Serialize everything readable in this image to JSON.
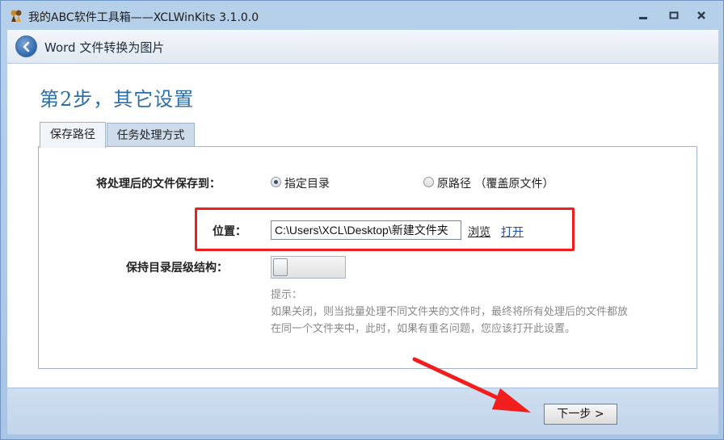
{
  "titlebar": {
    "title": "我的ABC软件工具箱——XCLWinKits  3.1.0.0",
    "icon": "app-logo-icon",
    "buttons": [
      "minimize-icon",
      "restore-icon",
      "close-icon"
    ]
  },
  "header": {
    "back_icon": "back-arrow-icon",
    "title": "Word 文件转换为图片"
  },
  "step_title": "第2步，其它设置",
  "tabs": [
    {
      "label": "保存路径",
      "active": true
    },
    {
      "label": "任务处理方式",
      "active": false
    }
  ],
  "save_to": {
    "label": "将处理后的文件保存到：",
    "options": [
      {
        "label": "指定目录",
        "selected": true
      },
      {
        "label": "原路径 （覆盖原文件）",
        "selected": false
      }
    ]
  },
  "location": {
    "label": "位置：",
    "value": "C:\\Users\\XCL\\Desktop\\新建文件夹",
    "browse": "浏览",
    "open": "打开"
  },
  "keep_structure": {
    "label": "保持目录层级结构：",
    "enabled": false
  },
  "hint": {
    "title": "提示：",
    "line1": "如果关闭，则当批量处理不同文件夹的文件时，最终将所有处理后的文件都放",
    "line2": "在同一个文件夹中，此时，如果有重名问题，您应该打开此设置。"
  },
  "footer": {
    "next": "下一步 >"
  },
  "colors": {
    "accent": "#2b6ea8",
    "highlight": "#f21d1d",
    "link": "#1a4fb5"
  }
}
